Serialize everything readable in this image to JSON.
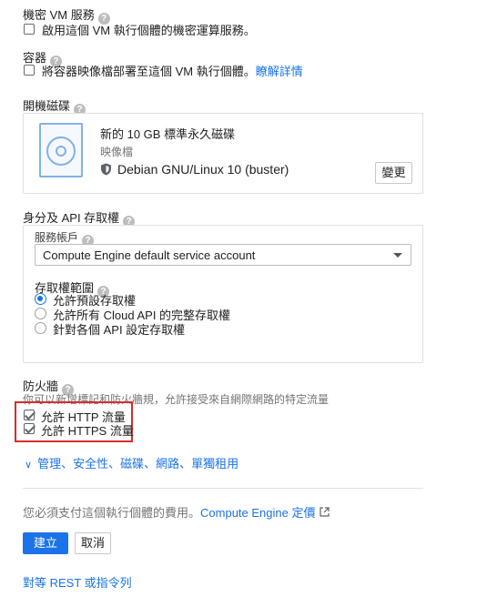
{
  "confidential_vm": {
    "title": "機密 VM 服務",
    "checkbox_label": "啟用這個 VM 執行個體的機密運算服務。",
    "checked": false
  },
  "container": {
    "title": "容器",
    "checkbox_label": "將容器映像檔部署至這個 VM 執行個體。",
    "learn_more": "瞭解詳情",
    "checked": false
  },
  "boot_disk": {
    "title": "開機磁碟",
    "disk_name": "新的 10 GB 標準永久磁碟",
    "image_label": "映像檔",
    "image_value": "Debian GNU/Linux 10 (buster)",
    "change_button": "變更",
    "icon": "disk-icon"
  },
  "identity": {
    "title": "身分及 API 存取權",
    "service_account_label": "服務帳戶",
    "service_account_value": "Compute Engine default service account",
    "scopes_label": "存取權範圍",
    "scopes": [
      {
        "label": "允許預設存取權",
        "selected": true
      },
      {
        "label": "允許所有 Cloud API 的完整存取權",
        "selected": false
      },
      {
        "label": "針對各個 API 設定存取權",
        "selected": false
      }
    ]
  },
  "firewall": {
    "title": "防火牆",
    "description": "你可以新增標記和防火牆規，允許接受來自網際網路的特定流量",
    "http_label": "允許 HTTP 流量",
    "https_label": "允許 HTTPS 流量",
    "http_checked": true,
    "https_checked": true,
    "highlight_color": "#d32f2f"
  },
  "expand_link": "管理、安全性、磁碟、網路、單獨租用",
  "billing": {
    "text": "您必須支付這個執行個體的費用。",
    "link": "Compute Engine 定價"
  },
  "actions": {
    "create": "建立",
    "cancel": "取消"
  },
  "equivalent_link": "對等 REST 或指令列",
  "colors": {
    "accent": "#1a73e8",
    "highlight": "#d32f2f"
  }
}
